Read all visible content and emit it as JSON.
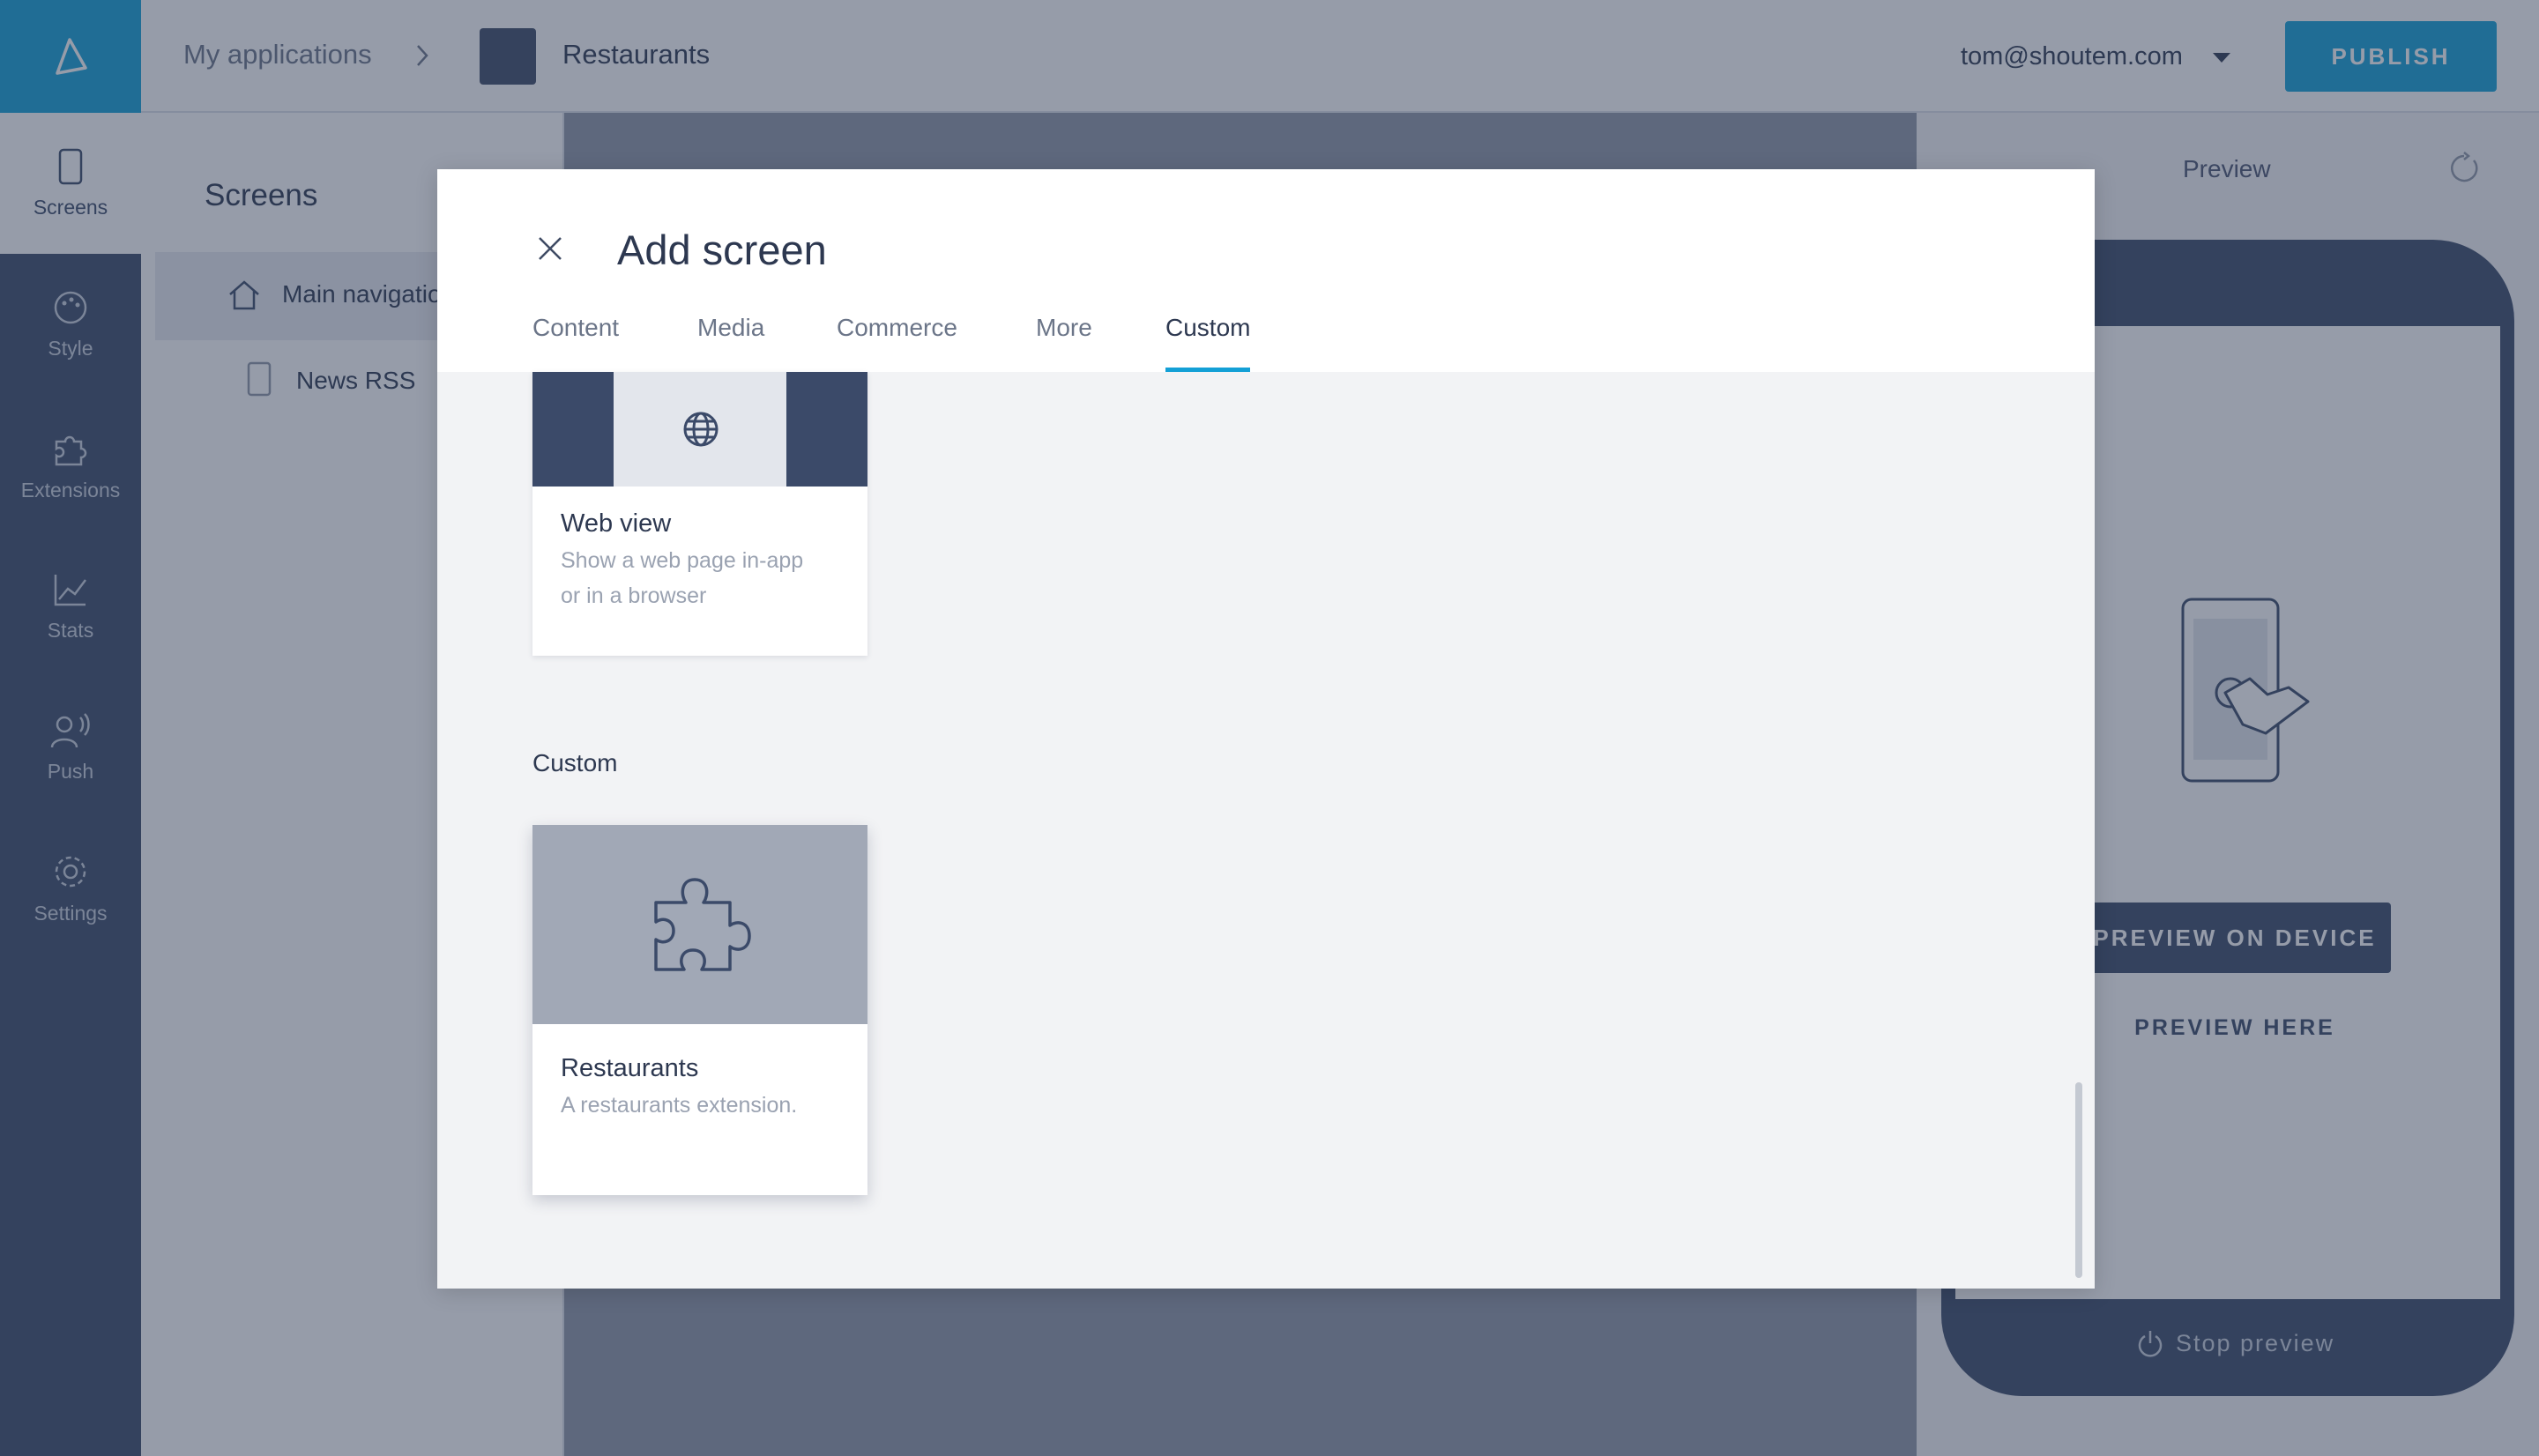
{
  "header": {
    "breadcrumb_apps": "My applications",
    "app_name": "Restaurants",
    "user_email": "tom@shoutem.com",
    "publish_label": "PUBLISH"
  },
  "sidebar": {
    "items": [
      {
        "label": "Screens",
        "icon": "phone-icon",
        "active": true
      },
      {
        "label": "Style",
        "icon": "palette-icon"
      },
      {
        "label": "Extensions",
        "icon": "puzzle-icon"
      },
      {
        "label": "Stats",
        "icon": "chart-icon"
      },
      {
        "label": "Push",
        "icon": "broadcast-icon"
      },
      {
        "label": "Settings",
        "icon": "gear-icon"
      }
    ]
  },
  "screens_panel": {
    "title": "Screens",
    "main_nav_label": "Main navigation",
    "rss_label": "News RSS"
  },
  "preview": {
    "title": "Preview",
    "preview_on_device": "PREVIEW ON DEVICE",
    "preview_here": "PREVIEW HERE",
    "stop_preview": "Stop preview"
  },
  "modal": {
    "title": "Add screen",
    "tabs": [
      {
        "label": "Content"
      },
      {
        "label": "Media"
      },
      {
        "label": "Commerce"
      },
      {
        "label": "More"
      },
      {
        "label": "Custom",
        "active": true
      }
    ],
    "webview_card": {
      "title": "Web view",
      "desc_line1": "Show a web page in-app",
      "desc_line2": "or in a browser",
      "icon": "globe-icon"
    },
    "section_label": "Custom",
    "restaurants_card": {
      "title": "Restaurants",
      "desc": "A restaurants extension.",
      "icon": "puzzle-icon"
    }
  },
  "colors": {
    "accent": "#13a0d6",
    "sidebar": "#3b4a69",
    "text_dark": "#2d3850",
    "text_muted": "#9aa2b1"
  }
}
